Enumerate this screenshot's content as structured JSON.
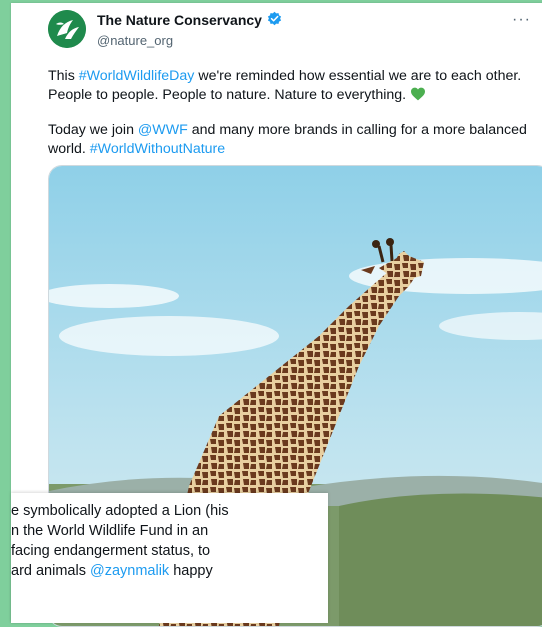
{
  "tweet": {
    "author_name": "The Nature Conservancy",
    "author_handle": "@nature_org",
    "more_label": "···",
    "para1_pre": "This ",
    "para1_hashtag": "#WorldWildlifeDay",
    "para1_post": " we're reminded how essential we are to each other. People to people. People to nature. Nature to everything.",
    "para2_pre": "Today we join ",
    "para2_mention": "@WWF",
    "para2_mid": " and many more brands in calling for a more balanced world. ",
    "para2_hashtag": "#WorldWithoutNature"
  },
  "overlay": {
    "line1": "e symbolically adopted a Lion (his",
    "line2": "n the World Wildlife Fund in an",
    "line3": " facing endangerment status, to",
    "line4_pre": "ard animals ",
    "line4_mention": "@zaynmalik",
    "line4_post": " happy"
  },
  "icons": {
    "verified": "verified-badge-icon",
    "heart": "green-heart-icon",
    "logo": "nature-conservancy-logo-icon"
  },
  "colors": {
    "background": "#7fcf9c",
    "link": "#1d9bf0",
    "verified": "#1d9bf0",
    "heart": "#4caf50",
    "logo": "#1f8a4c"
  }
}
